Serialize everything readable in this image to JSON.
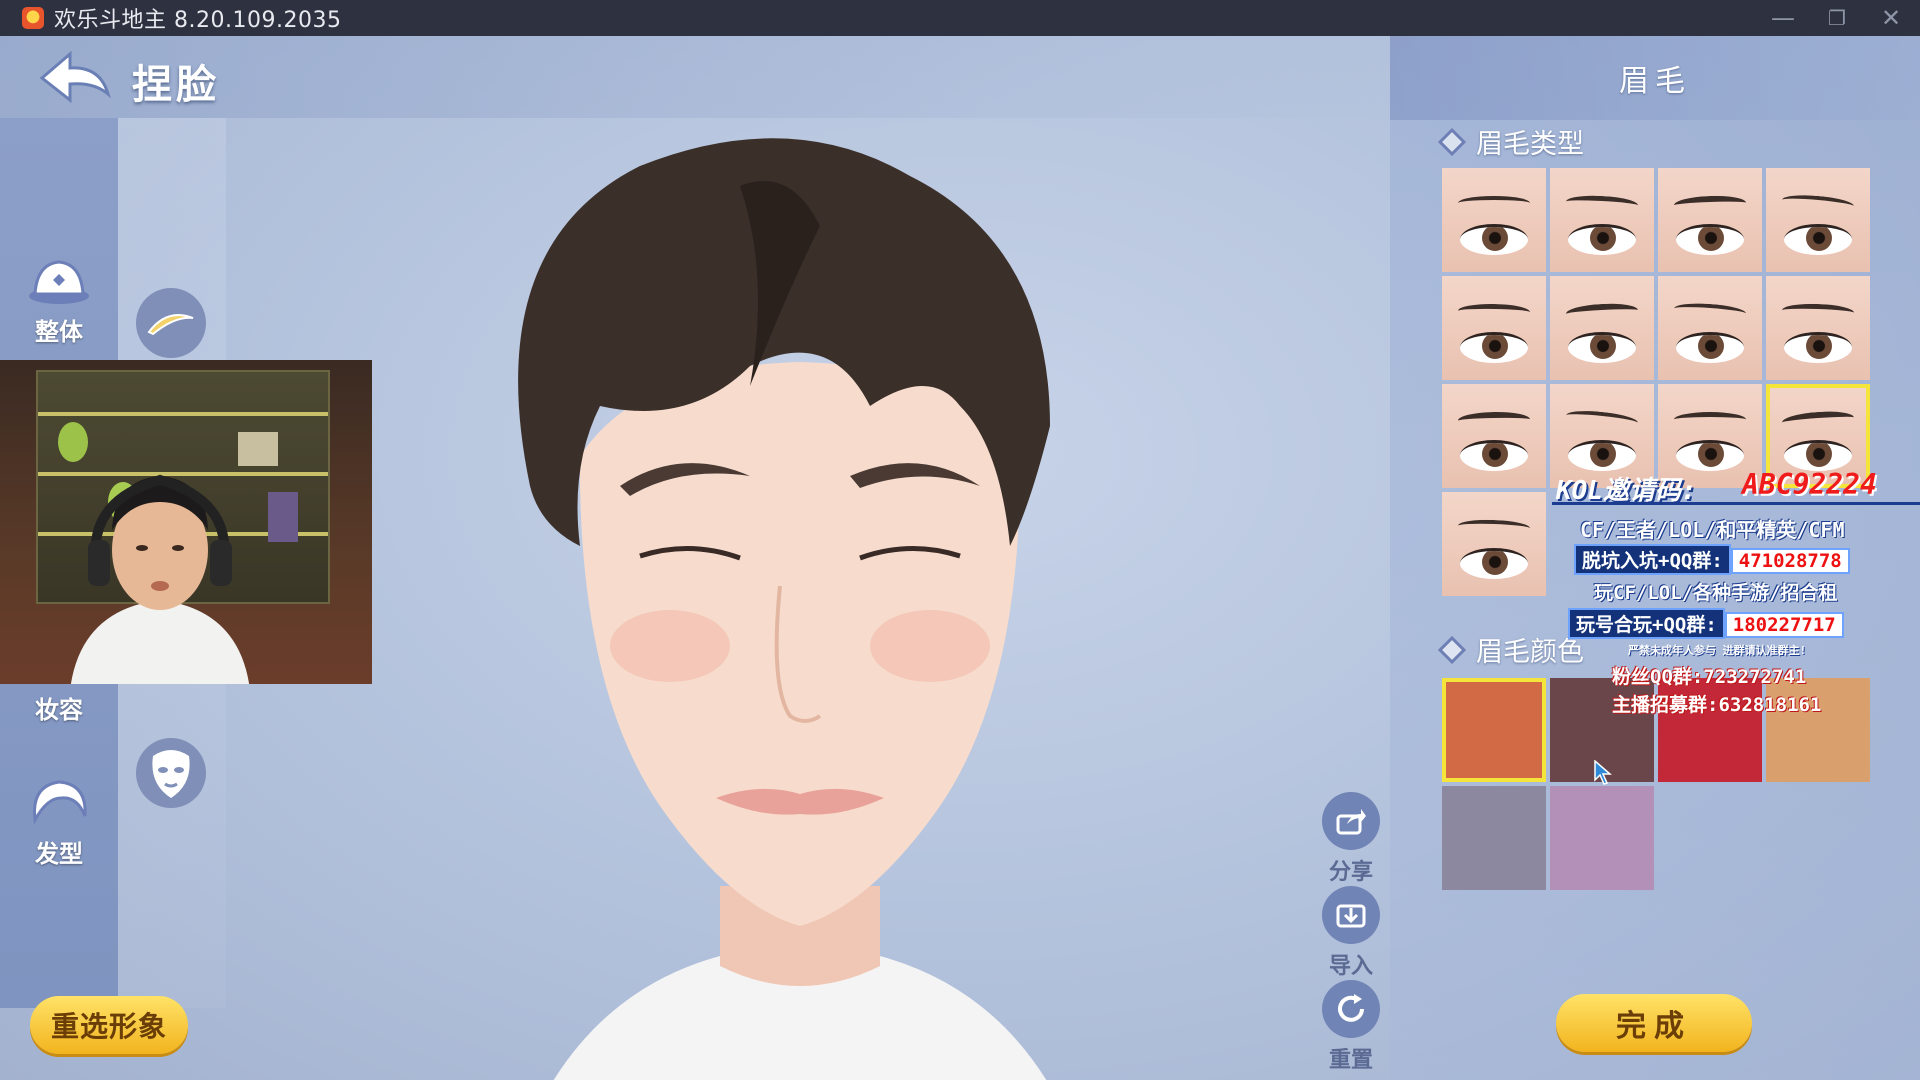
{
  "window": {
    "title": "欢乐斗地主 8.20.109.2035",
    "controls": {
      "minimize": "—",
      "restore": "❐",
      "close": "✕"
    }
  },
  "header": {
    "title": "捏脸"
  },
  "left_nav": {
    "items": [
      {
        "label": "整体",
        "icon": "hat-icon"
      },
      {
        "label": "妆容",
        "icon": "makeup-icon"
      },
      {
        "label": "发型",
        "icon": "hair-icon"
      }
    ]
  },
  "right_panel": {
    "title": "眉毛",
    "brow_type_label": "眉毛类型",
    "brow_color_label": "眉毛颜色",
    "brow_type_selected_index": 11,
    "brow_colors": [
      "#d16a45",
      "#6a464a",
      "#c32838",
      "#d9a06e",
      "#8c889f",
      "#b290b8"
    ],
    "brow_color_selected_index": 0
  },
  "side_actions": {
    "share": "分享",
    "import": "导入",
    "reset": "重置"
  },
  "buttons": {
    "reselect": "重选形象",
    "done": "完成"
  },
  "stream_overlay": {
    "kol_label": "KOL邀请码:",
    "kol_code": "ABC92224",
    "games_line1": "CF/王者/LOL/和平精英/CFM",
    "group1_label": "脱坑入坑+QQ群:",
    "group1_number": "471028778",
    "games_line2": "玩CF/LOL/各种手游/招合租",
    "group2_label": "玩号合玩+QQ群:",
    "group2_number": "180227717",
    "notice": "严禁未成年人参与  进群请认准群主!",
    "fan_group": "粉丝QQ群:723272741",
    "streamer_group": "主播招募群:632818161"
  }
}
